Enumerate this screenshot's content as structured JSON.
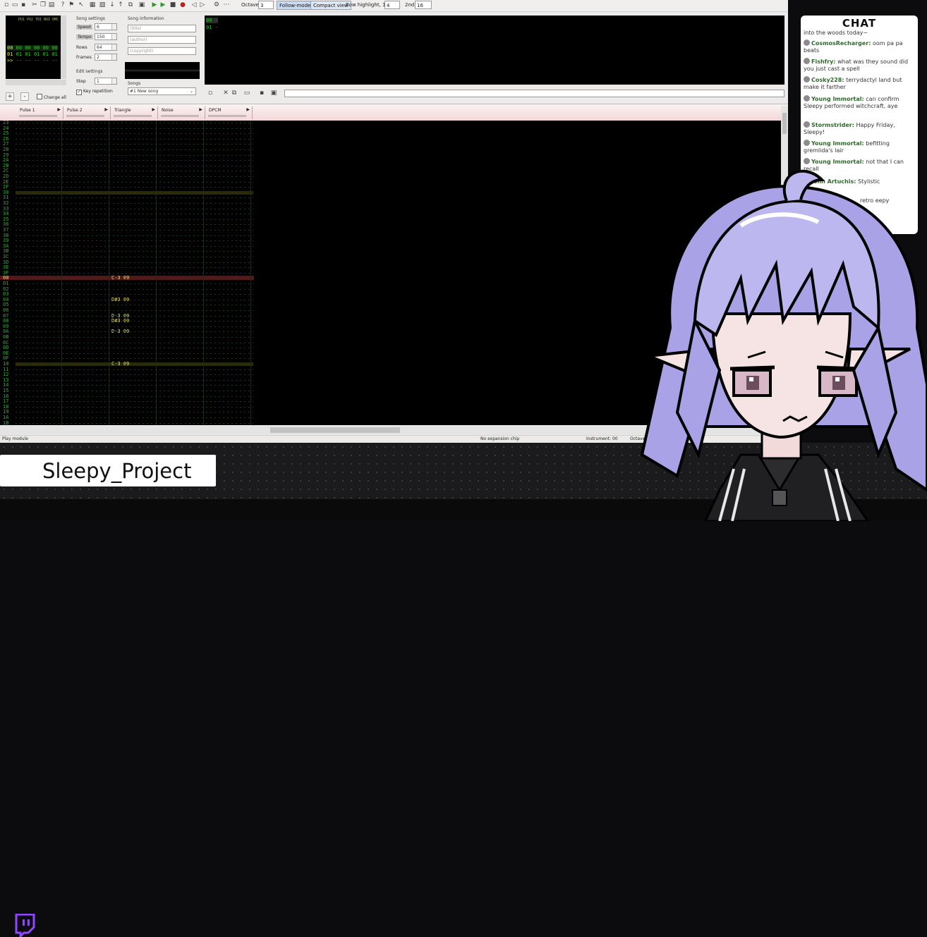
{
  "toolbar": {
    "octave_label": "Octave",
    "octave_value": "3",
    "follow_mode": "Follow-mode",
    "compact_view": "Compact view",
    "row_highlight_label": "Row highlight, 1st",
    "row_highlight_1st": "4",
    "row_highlight_2nd_label": "2nd",
    "row_highlight_2nd": "16"
  },
  "frames": {
    "header": "PU1 PU2 TRI NOI DMC",
    "rows": [
      {
        "num": "00",
        "cells": "00 00 00 00 00"
      },
      {
        "num": "01",
        "cells": "01 01 01 01 01"
      },
      {
        "num": ">>",
        "cells": "-- -- -- -- --"
      }
    ]
  },
  "song_settings": {
    "title": "Song settings",
    "speed_label": "Speed",
    "speed": "6",
    "tempo_label": "Tempo",
    "tempo": "150",
    "rows_label": "Rows",
    "rows": "64",
    "frames_label": "Frames",
    "frames": "2"
  },
  "edit_settings": {
    "title": "Edit settings",
    "step_label": "Step",
    "step": "1",
    "key_repetition": "Key repetition"
  },
  "song_info": {
    "title": "Song information",
    "title_placeholder": "(title)",
    "author_placeholder": "(author)",
    "copyright_placeholder": "(copyright)",
    "songs_label": "Songs",
    "song_selected": "#1 New song"
  },
  "frame_controls": {
    "add": "+",
    "remove": "-",
    "change_all": "Change all"
  },
  "instruments": [
    {
      "text": "00 -"
    },
    {
      "text": "01 -"
    }
  ],
  "channels": [
    "Pulse 1",
    "Pulse 2",
    "Triangle",
    "Noise",
    "DPCM"
  ],
  "pattern": {
    "rows_top": [
      "23",
      "24",
      "25",
      "26",
      "27",
      "28",
      "29",
      "2A",
      "2B",
      "2C",
      "2D",
      "2E",
      "2F",
      "30",
      "31",
      "32",
      "33",
      "34",
      "35",
      "36",
      "37",
      "38",
      "39",
      "3A",
      "3B",
      "3C",
      "3D",
      "3E",
      "3F"
    ],
    "rows_bottom": [
      "00",
      "01",
      "02",
      "03",
      "04",
      "05",
      "06",
      "07",
      "08",
      "09",
      "0A",
      "0B",
      "0C",
      "0D",
      "0E",
      "0F",
      "10",
      "11",
      "12",
      "13",
      "14",
      "15",
      "16",
      "17",
      "18",
      "19",
      "1A",
      "1B"
    ],
    "notes": [
      {
        "row": "00",
        "text": "C-3 00"
      },
      {
        "row": "04",
        "text": "D#3 00"
      },
      {
        "row": "07",
        "text": "D-3 00"
      },
      {
        "row": "08",
        "text": "D#3 00"
      },
      {
        "row": "0A",
        "text": "D-3 00"
      },
      {
        "row": "10",
        "text": "C-3 00"
      }
    ]
  },
  "status": {
    "left": "Play module",
    "chip": "No expansion chip",
    "instrument": "Instrument: 00",
    "octave": "Octave:"
  },
  "overlay": {
    "channel_name": "Sleepy_Project",
    "chat_title": "CHAT",
    "chat_messages": [
      {
        "user": "",
        "text": "into the woods today~"
      },
      {
        "user": "CosmosRecharger:",
        "text": "oom pa pa beats"
      },
      {
        "user": "Fishfry:",
        "text": "what was they sound did you just cast a spell"
      },
      {
        "user": "Cosky228:",
        "text": "terrydactyl land but make it farther"
      },
      {
        "user": "Young Immortal:",
        "text": "can confirm Sleepy performed witchcraft, aye"
      },
      {
        "user": "Stormstrider:",
        "text": "Happy Friday, Sleepy!"
      },
      {
        "user": "Young Immortal:",
        "text": "befitting gremlida's lair"
      },
      {
        "user": "Young Immortal:",
        "text": "not that I can recall"
      },
      {
        "user": "John Artuchis:",
        "text": "Stylistic"
      },
      {
        "user": "",
        "text": "retro eepy"
      }
    ]
  },
  "colors": {
    "pattern_bg": "#000000",
    "note": "#e6e04a",
    "row_number": "#2fb02f",
    "cursor_row": "#5a1518",
    "hair": "#b8b2ee",
    "channel_header": "#f3d6d8"
  }
}
